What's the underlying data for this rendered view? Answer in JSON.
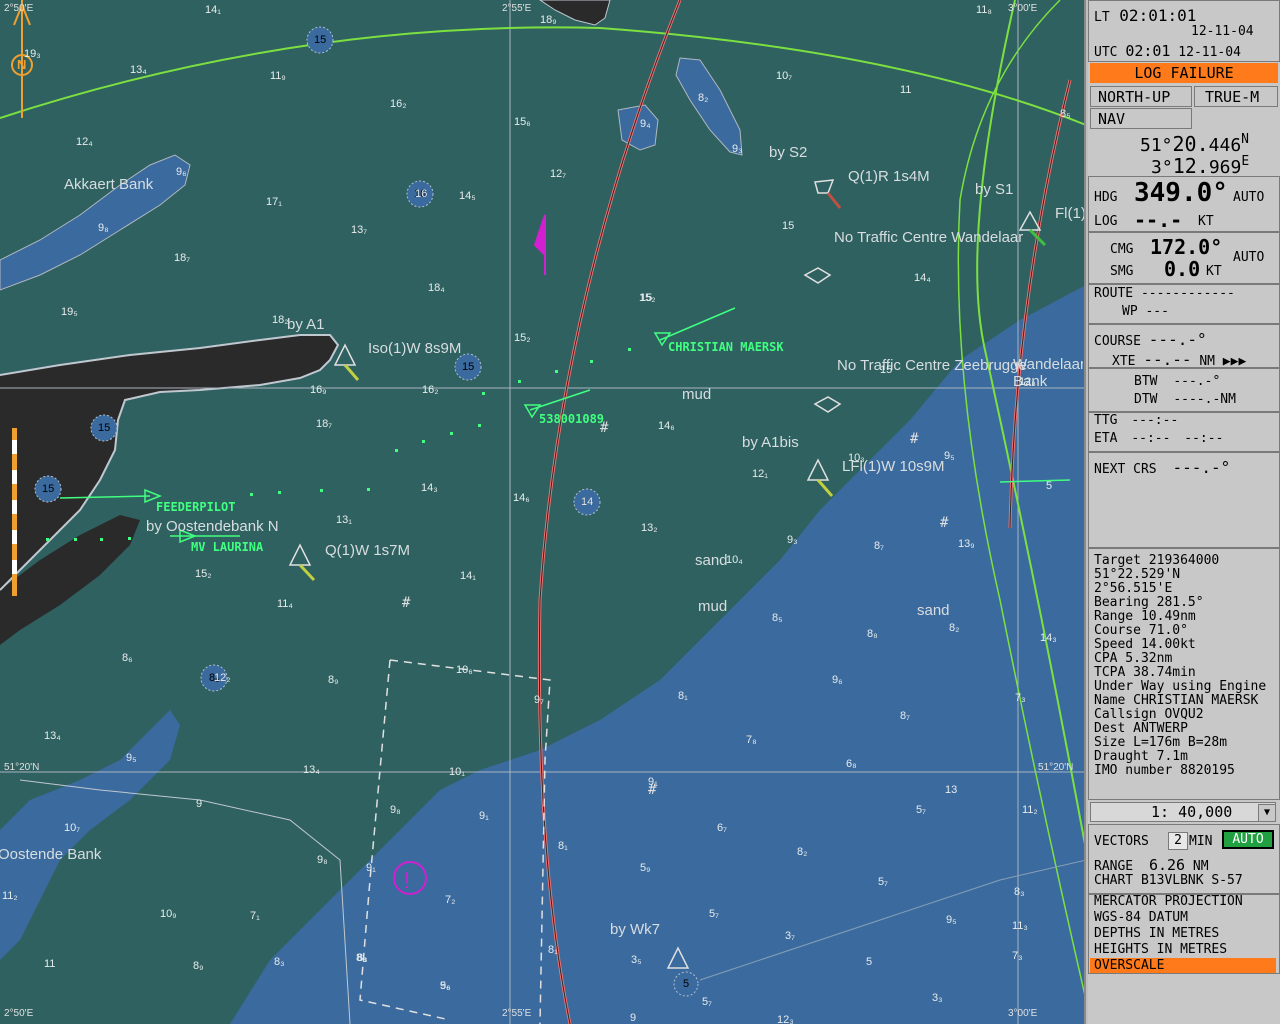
{
  "chart": {
    "areas": [
      "Akkaert Bank",
      "Oostende Bank",
      "Wandelaar Bank"
    ],
    "buoys": [
      {
        "name": "by A1",
        "light": "Iso(1)W 8s9M"
      },
      {
        "name": "by Oostendebank N",
        "light": "Q(1)W 1s7M"
      },
      {
        "name": "by A1bis",
        "light": "LFl(1)W 10s9M"
      },
      {
        "name": "by S2",
        "light": "Q(1)R 1s4M"
      },
      {
        "name": "by S1",
        "light": "Fl(1)"
      },
      {
        "name": "by Wk7",
        "light": ""
      }
    ],
    "notes": [
      "No Traffic Centre Wandelaar",
      "No Traffic Centre Zeebrugge"
    ],
    "seabed": [
      "mud",
      "mud",
      "sand",
      "sand",
      "mud"
    ],
    "vessels": [
      "CHRISTIAN MAERSK",
      "538001089",
      "FEEDERPILOT",
      "MV LAURINA"
    ],
    "grid_labels": {
      "top": [
        "2°50'E",
        "2°55'E",
        "3°00'E"
      ],
      "bottom": [
        "2°50'E",
        "2°55'E",
        "3°00'E"
      ],
      "left": "51°20'N",
      "right": "51°20'N"
    },
    "north_symbol": "N",
    "depths": [
      "14₁",
      "18₉",
      "11₈",
      "19₃",
      "13₄",
      "11₉",
      "16₂",
      "15₆",
      "12₇",
      "10₇",
      "11",
      "12₄",
      "9₆",
      "16",
      "14₅",
      "8₂",
      "9₄",
      "9₃",
      "17₁",
      "13₇",
      "9₈",
      "18₇",
      "18₄",
      "15",
      "15₂",
      "14₄",
      "19₅",
      "18₂",
      "15₂",
      "15",
      "16₂",
      "16₉",
      "18₇",
      "14₆",
      "15",
      "14₃",
      "14₆",
      "14",
      "13₂",
      "10₃",
      "9₅",
      "12₁",
      "12₈",
      "13₁",
      "15₂",
      "11₄",
      "14₁",
      "10₄",
      "9₃",
      "8₇",
      "13₉",
      "8₉",
      "8₈",
      "9₆",
      "8₅",
      "8₂",
      "14₃",
      "8₆",
      "12₂",
      "10₆",
      "9₇",
      "8₁",
      "7₃",
      "13₄",
      "9₅",
      "13₄",
      "10₁",
      "9₁",
      "8₇",
      "7₈",
      "6₈",
      "13",
      "9",
      "10₇",
      "9₈",
      "9₁",
      "8₁",
      "6₇",
      "5₇",
      "11₂",
      "9₈",
      "9₁",
      "7₂",
      "8₂",
      "5₉",
      "5₇",
      "8₃",
      "11₂",
      "10₉",
      "7₁",
      "5₇",
      "3₇",
      "9₅",
      "8₃",
      "8₃",
      "9₆",
      "8₁",
      "9",
      "7₃",
      "3₅",
      "5",
      "11₃",
      "11",
      "8₉",
      "8₃",
      "5₆",
      "5₇",
      "3₃",
      "12₃",
      "8₅",
      "5"
    ]
  },
  "panel": {
    "lt_label": "LT",
    "lt_time": "02:01:01",
    "lt_date": "12-11-04",
    "utc_label": "UTC",
    "utc_time": "02:01",
    "utc_date": "12-11-04",
    "alarm": "LOG FAILURE",
    "orientation": "NORTH-UP",
    "motion": "TRUE-M",
    "mode": "NAV",
    "lat_deg": "51°",
    "lat_min": "20.",
    "lat_dec": "446",
    "lat_hemi": "N",
    "lon_deg": "3°",
    "lon_min": "12.",
    "lon_dec": "969",
    "lon_hemi": "E",
    "hdg_label": "HDG",
    "hdg_value": "349.0°",
    "hdg_mode": "AUTO",
    "log_label": "LOG",
    "log_value": "--.-",
    "log_unit": "KT",
    "cmg_label": "CMG",
    "cmg_value": "172.0°",
    "smg_label": "SMG",
    "smg_value": "0.0",
    "smg_unit": "KT",
    "cmg_mode": "AUTO",
    "route_label": "ROUTE",
    "route_value": "------------",
    "wp_label": "WP",
    "wp_value": "---",
    "course_label": "COURSE",
    "course_value": "---.-°",
    "xte_label": "XTE",
    "xte_value": "--.--",
    "xte_unit": "NM",
    "xte_arrows": "▶▶▶",
    "btw_label": "BTW",
    "btw_value": "---.-°",
    "dtw_label": "DTW",
    "dtw_value": "----.-",
    "dtw_unit": "NM",
    "ttg_label": "TTG",
    "ttg_value": "---:--",
    "eta_label": "ETA",
    "eta_time": "--:--",
    "eta_date": "--:--",
    "next_label": "NEXT CRS",
    "next_value": "---.-°",
    "target": [
      "Target 219364000",
      " 51°22.529'N",
      "  2°56.515'E",
      "Bearing 281.5°",
      "Range    10.49nm",
      "Course   71.0°",
      "Speed    14.00kt",
      "CPA      5.32nm",
      "TCPA     38.74min",
      "Under Way using Engine",
      "Name CHRISTIAN MAERSK",
      "Callsign  OVQU2",
      "Dest ANTWERP",
      "Size L=176m B=28m",
      "Draught 7.1m",
      "IMO number  8820195"
    ],
    "scale": "1: 40,000",
    "vectors_label": "VECTORS",
    "vectors_value": "2",
    "vectors_unit": "MIN",
    "vectors_mode": "AUTO",
    "range_label": "RANGE",
    "range_value": "6.26",
    "range_unit": "NM",
    "chart_label": "CHART",
    "chart_value": "B13VLBNK S-57",
    "info": [
      "MERCATOR PROJECTION",
      "WGS-84 DATUM",
      "DEPTHS IN METRES",
      "HEIGHTS IN METRES"
    ],
    "overscale": "OVERSCALE"
  }
}
